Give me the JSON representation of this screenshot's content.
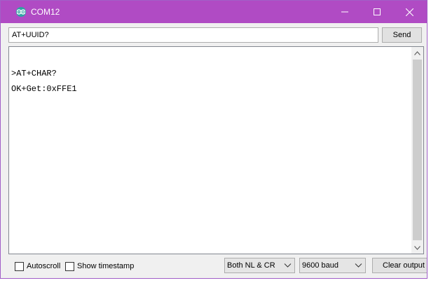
{
  "window": {
    "title": "COM12",
    "accent_color": "#b04bc4"
  },
  "send_row": {
    "input_value": "AT+UUID?",
    "send_label": "Send"
  },
  "output": {
    "lines": [
      ">AT+CHAR?",
      "OK+Get:0xFFE1"
    ]
  },
  "bottom": {
    "autoscroll_label": "Autoscroll",
    "autoscroll_checked": false,
    "timestamp_label": "Show timestamp",
    "timestamp_checked": false,
    "line_ending": "Both NL & CR",
    "baud_rate": "9600 baud",
    "clear_label": "Clear output"
  },
  "icons": {
    "app": "arduino-icon",
    "minimize": "minimize-icon",
    "maximize": "maximize-icon",
    "close": "close-icon",
    "scroll_up": "chevron-up-icon",
    "scroll_down": "chevron-down-icon",
    "dropdown": "chevron-down-icon"
  }
}
